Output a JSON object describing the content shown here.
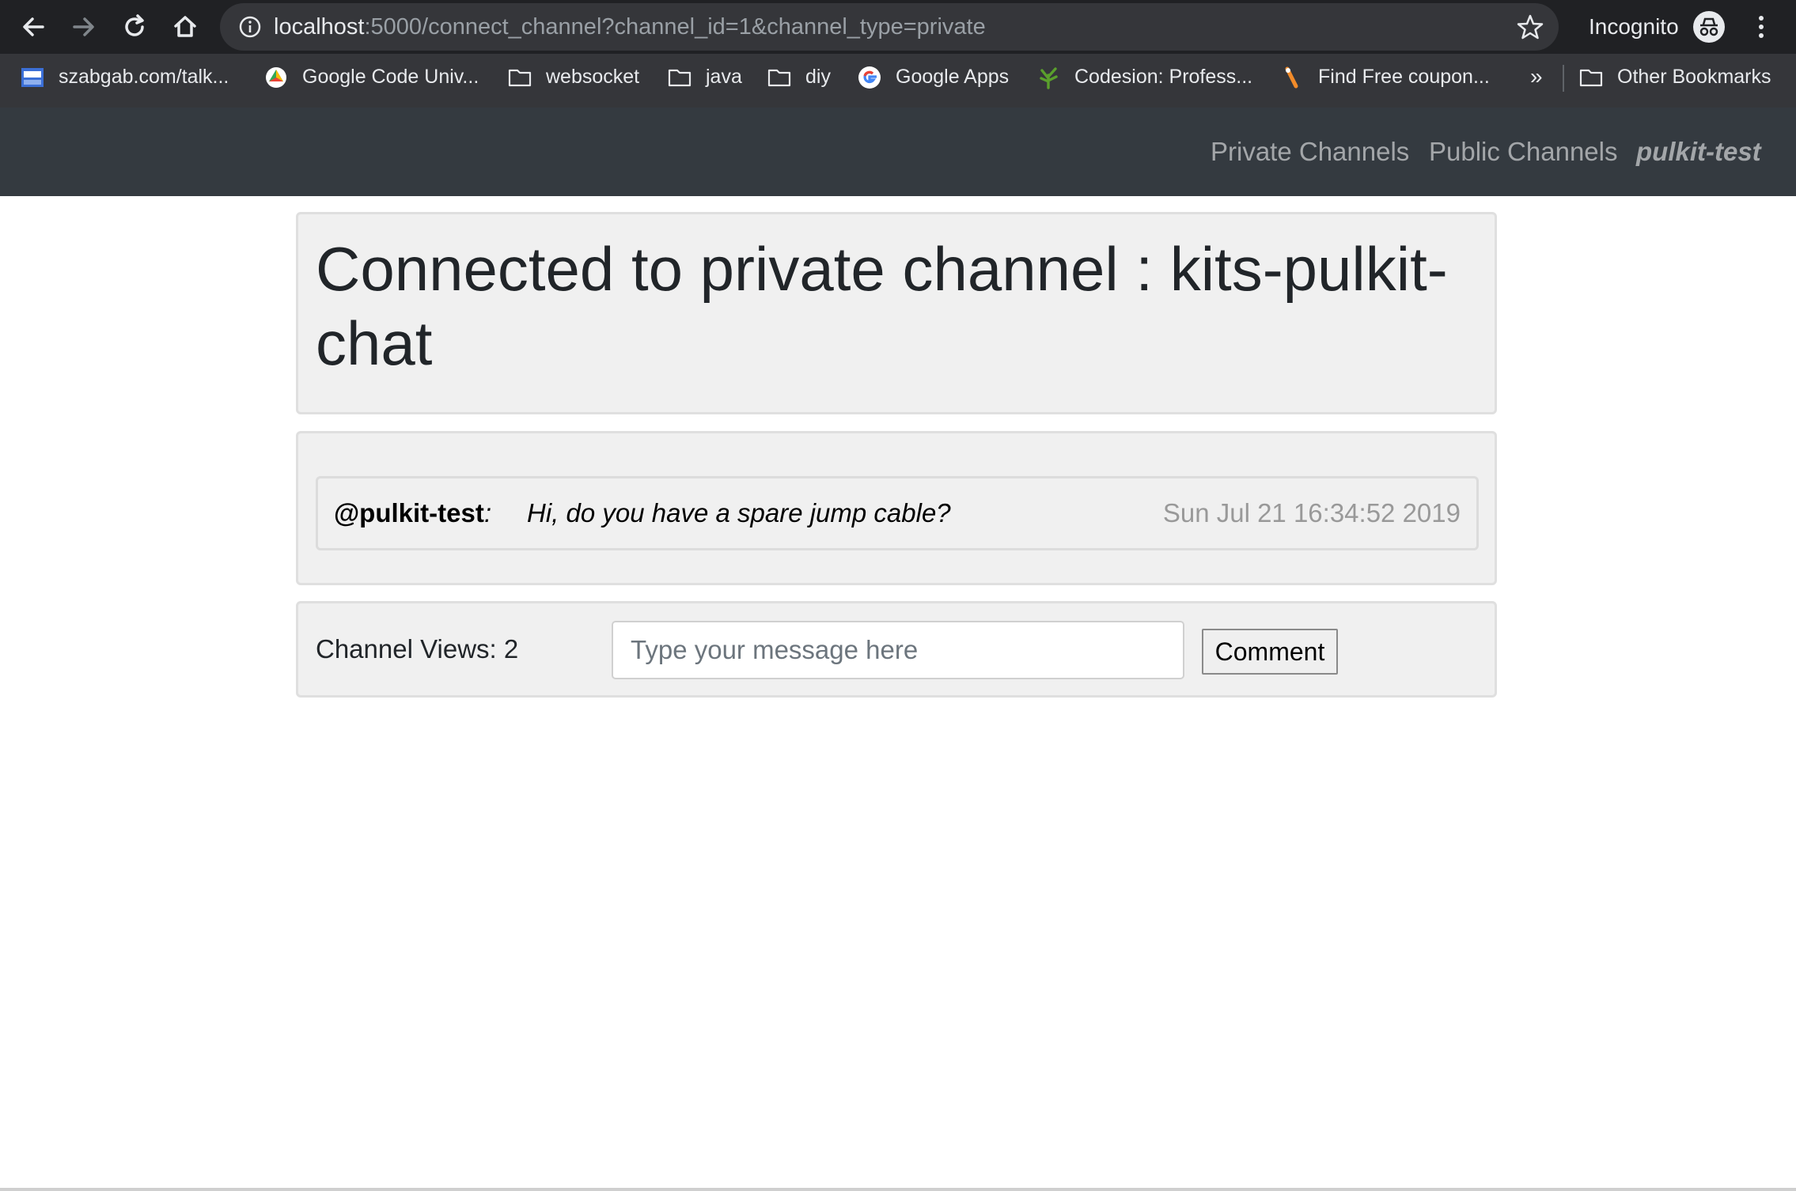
{
  "browser": {
    "url_host": "localhost",
    "url_rest": ":5000/connect_channel?channel_id=1&channel_type=private",
    "incognito_label": "Incognito",
    "bookmarks": [
      {
        "label": "szabgab.com/talk...",
        "icon": "site-favicon"
      },
      {
        "label": "Google Code Univ...",
        "icon": "google-code-icon"
      },
      {
        "label": "websocket",
        "icon": "folder-icon"
      },
      {
        "label": "java",
        "icon": "folder-icon"
      },
      {
        "label": "diy",
        "icon": "folder-icon"
      },
      {
        "label": "Google Apps",
        "icon": "google-icon"
      },
      {
        "label": "Codesion: Profess...",
        "icon": "codesion-icon"
      },
      {
        "label": "Find Free coupon...",
        "icon": "coupon-icon"
      }
    ],
    "more_label": "»",
    "other_bookmarks": "Other Bookmarks"
  },
  "navbar": {
    "links": [
      "Private Channels",
      "Public Channels"
    ],
    "user": "pulkit-test"
  },
  "channel": {
    "title": "Connected to private channel : kits-pulkit-chat"
  },
  "messages": [
    {
      "user": "@pulkit-test",
      "separator": ":",
      "text": "Hi, do you have a spare jump cable?",
      "time": "Sun Jul 21 16:34:52 2019"
    }
  ],
  "comment_form": {
    "views_label": "Channel Views: 2",
    "placeholder": "Type your message here",
    "button_label": "Comment"
  },
  "colors": {
    "navbar_bg": "#343a40",
    "panel_bg": "#f0f0f0",
    "timestamp": "#999999"
  }
}
